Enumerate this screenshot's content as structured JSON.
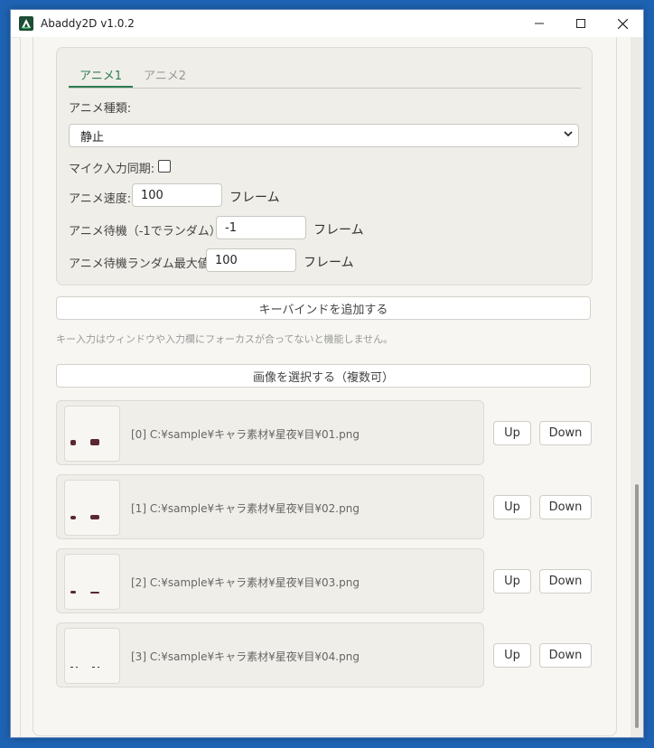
{
  "window": {
    "title": "Abaddy2D v1.0.2",
    "app_icon": "app-logo-icon",
    "minimize": "─",
    "maximize": "☐",
    "close": "✕"
  },
  "tabs": [
    {
      "label": "アニメ1",
      "active": true
    },
    {
      "label": "アニメ2",
      "active": false
    }
  ],
  "anim": {
    "type_label": "アニメ種類:",
    "type_value": "静止",
    "mic_label": "マイク入力同期:",
    "mic_checked": false,
    "speed_label": "アニメ速度:",
    "speed_value": "100",
    "speed_unit": "フレーム",
    "wait_label": "アニメ待機（-1でランダム）:",
    "wait_value": "-1",
    "wait_unit": "フレーム",
    "wait_max_label": "アニメ待機ランダム最大値:",
    "wait_max_value": "100",
    "wait_max_unit": "フレーム"
  },
  "add_keybind_label": "キーバインドを追加する",
  "keybind_note": "キー入力はウィンドウや入力欄にフォーカスが合ってないと機能しません。",
  "select_images_label": "画像を選択する（複数可）",
  "images": [
    {
      "path": "[0] C:¥sample¥キャラ素材¥星夜¥目¥01.png",
      "up": "Up",
      "down": "Down"
    },
    {
      "path": "[1] C:¥sample¥キャラ素材¥星夜¥目¥02.png",
      "up": "Up",
      "down": "Down"
    },
    {
      "path": "[2] C:¥sample¥キャラ素材¥星夜¥目¥03.png",
      "up": "Up",
      "down": "Down"
    },
    {
      "path": "[3] C:¥sample¥キャラ素材¥星夜¥目¥04.png",
      "up": "Up",
      "down": "Down"
    }
  ],
  "colors": {
    "accent": "#2e7d52",
    "desktop": "#1e63b3",
    "panel": "#f0eee9"
  }
}
